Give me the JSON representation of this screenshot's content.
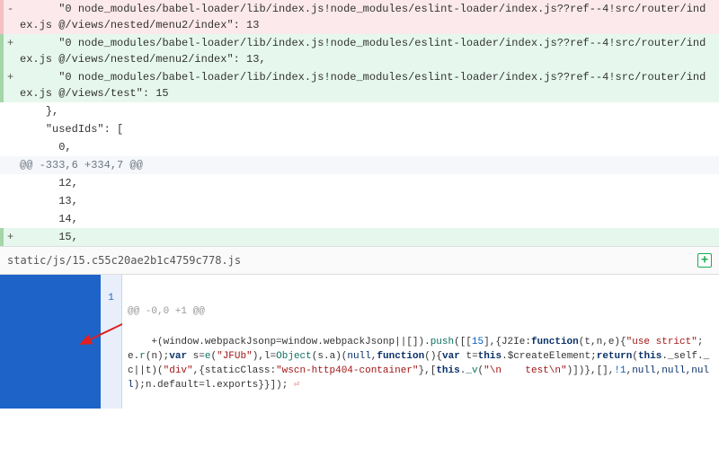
{
  "diff": {
    "lines": [
      {
        "type": "del",
        "sign": "-",
        "text": "      \"0 node_modules/babel-loader/lib/index.js!node_modules/eslint-loader/index.js??ref--4!src/router/index.js @/views/nested/menu2/index\": 13"
      },
      {
        "type": "add",
        "sign": "+",
        "text": "      \"0 node_modules/babel-loader/lib/index.js!node_modules/eslint-loader/index.js??ref--4!src/router/index.js @/views/nested/menu2/index\": 13,"
      },
      {
        "type": "add",
        "sign": "+",
        "text": "      \"0 node_modules/babel-loader/lib/index.js!node_modules/eslint-loader/index.js??ref--4!src/router/index.js @/views/test\": 15"
      },
      {
        "type": "ctx",
        "sign": "",
        "text": "    },"
      },
      {
        "type": "ctx",
        "sign": "",
        "text": "    \"usedIds\": ["
      },
      {
        "type": "ctx",
        "sign": "",
        "text": "      0,"
      },
      {
        "type": "hunk",
        "sign": "",
        "text": "@@ -333,6 +334,7 @@"
      },
      {
        "type": "ctx",
        "sign": "",
        "text": "      12,"
      },
      {
        "type": "ctx",
        "sign": "",
        "text": "      13,"
      },
      {
        "type": "ctx",
        "sign": "",
        "text": "      14,"
      },
      {
        "type": "add",
        "sign": "+",
        "text": "      15,"
      }
    ]
  },
  "file": {
    "path": "static/js/15.c55c20ae2b1c4759c778.js",
    "add_icon_label": "+"
  },
  "code": {
    "hunk": "@@ -0,0 +1 @@",
    "line_number": "1",
    "tokens": [
      {
        "t": "op",
        "v": "+("
      },
      {
        "t": "id",
        "v": "window"
      },
      {
        "t": "op",
        "v": "."
      },
      {
        "t": "prop",
        "v": "webpackJsonp"
      },
      {
        "t": "op",
        "v": "="
      },
      {
        "t": "id",
        "v": "window"
      },
      {
        "t": "op",
        "v": "."
      },
      {
        "t": "prop",
        "v": "webpackJsonp"
      },
      {
        "t": "op",
        "v": "||[])."
      },
      {
        "t": "fn",
        "v": "push"
      },
      {
        "t": "op",
        "v": "([["
      },
      {
        "t": "num",
        "v": "15"
      },
      {
        "t": "op",
        "v": "],{"
      },
      {
        "t": "prop",
        "v": "J2Ie"
      },
      {
        "t": "op",
        "v": ":"
      },
      {
        "t": "kw",
        "v": "function"
      },
      {
        "t": "op",
        "v": "("
      },
      {
        "t": "id",
        "v": "t"
      },
      {
        "t": "op",
        "v": ","
      },
      {
        "t": "id",
        "v": "n"
      },
      {
        "t": "op",
        "v": ","
      },
      {
        "t": "id",
        "v": "e"
      },
      {
        "t": "op",
        "v": "){"
      },
      {
        "t": "str",
        "v": "\"use strict\""
      },
      {
        "t": "op",
        "v": ";"
      },
      {
        "t": "id",
        "v": "e"
      },
      {
        "t": "op",
        "v": "."
      },
      {
        "t": "fn",
        "v": "r"
      },
      {
        "t": "op",
        "v": "("
      },
      {
        "t": "id",
        "v": "n"
      },
      {
        "t": "op",
        "v": ");"
      },
      {
        "t": "kw",
        "v": "var"
      },
      {
        "t": "op",
        "v": " "
      },
      {
        "t": "id",
        "v": "s"
      },
      {
        "t": "op",
        "v": "="
      },
      {
        "t": "fn",
        "v": "e"
      },
      {
        "t": "op",
        "v": "("
      },
      {
        "t": "str",
        "v": "\"JFUb\""
      },
      {
        "t": "op",
        "v": "),"
      },
      {
        "t": "id",
        "v": "l"
      },
      {
        "t": "op",
        "v": "="
      },
      {
        "t": "fn",
        "v": "Object"
      },
      {
        "t": "op",
        "v": "("
      },
      {
        "t": "id",
        "v": "s"
      },
      {
        "t": "op",
        "v": "."
      },
      {
        "t": "prop",
        "v": "a"
      },
      {
        "t": "op",
        "v": ")("
      },
      {
        "t": "null",
        "v": "null"
      },
      {
        "t": "op",
        "v": ","
      },
      {
        "t": "kw",
        "v": "function"
      },
      {
        "t": "op",
        "v": "(){"
      },
      {
        "t": "kw",
        "v": "var"
      },
      {
        "t": "op",
        "v": " "
      },
      {
        "t": "id",
        "v": "t"
      },
      {
        "t": "op",
        "v": "="
      },
      {
        "t": "this",
        "v": "this"
      },
      {
        "t": "op",
        "v": "."
      },
      {
        "t": "prop",
        "v": "$createElement"
      },
      {
        "t": "op",
        "v": ";"
      },
      {
        "t": "kw",
        "v": "return"
      },
      {
        "t": "op",
        "v": "("
      },
      {
        "t": "this",
        "v": "this"
      },
      {
        "t": "op",
        "v": "."
      },
      {
        "t": "prop",
        "v": "_self"
      },
      {
        "t": "op",
        "v": "."
      },
      {
        "t": "prop",
        "v": "_c"
      },
      {
        "t": "op",
        "v": "||"
      },
      {
        "t": "id",
        "v": "t"
      },
      {
        "t": "op",
        "v": ")("
      },
      {
        "t": "str",
        "v": "\"div\""
      },
      {
        "t": "op",
        "v": ",{"
      },
      {
        "t": "prop",
        "v": "staticClass"
      },
      {
        "t": "op",
        "v": ":"
      },
      {
        "t": "str",
        "v": "\"wscn-http404-container\""
      },
      {
        "t": "op",
        "v": "},["
      },
      {
        "t": "this",
        "v": "this"
      },
      {
        "t": "op",
        "v": "."
      },
      {
        "t": "fn",
        "v": "_v"
      },
      {
        "t": "op",
        "v": "("
      },
      {
        "t": "str",
        "v": "\"\\n    test\\n\""
      },
      {
        "t": "op",
        "v": ")])},[],"
      },
      {
        "t": "num",
        "v": "!1"
      },
      {
        "t": "op",
        "v": ","
      },
      {
        "t": "null",
        "v": "null"
      },
      {
        "t": "op",
        "v": ","
      },
      {
        "t": "null",
        "v": "null"
      },
      {
        "t": "op",
        "v": ","
      },
      {
        "t": "null",
        "v": "null"
      },
      {
        "t": "op",
        "v": ");"
      },
      {
        "t": "id",
        "v": "n"
      },
      {
        "t": "op",
        "v": "."
      },
      {
        "t": "prop",
        "v": "default"
      },
      {
        "t": "op",
        "v": "="
      },
      {
        "t": "id",
        "v": "l"
      },
      {
        "t": "op",
        "v": "."
      },
      {
        "t": "prop",
        "v": "exports"
      },
      {
        "t": "op",
        "v": "}}]);"
      },
      {
        "t": "eol",
        "v": " ⏎"
      }
    ]
  }
}
